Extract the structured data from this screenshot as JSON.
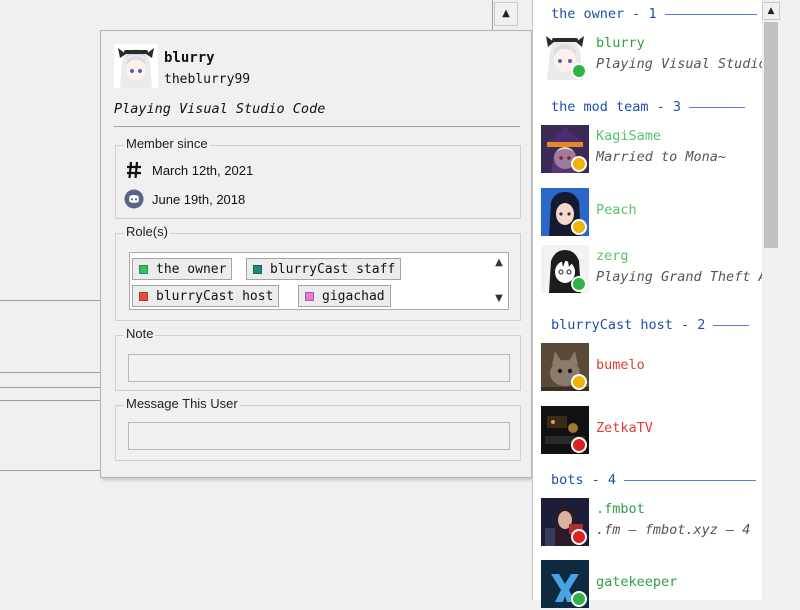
{
  "popup": {
    "display_name": "blurry",
    "username": "theblurry99",
    "status": "Playing Visual Studio Code",
    "member_since": {
      "title": "Member since",
      "server_date": "March 12th, 2021",
      "discord_date": "June 19th, 2018"
    },
    "roles": {
      "title": "Role(s)",
      "items": [
        {
          "name": "the owner",
          "color": "#33c266"
        },
        {
          "name": "blurryCast staff",
          "color": "#1f8a76"
        },
        {
          "name": "blurryCast host",
          "color": "#e74c3c"
        },
        {
          "name": "gigachad",
          "color": "#e27be0"
        }
      ]
    },
    "note": {
      "title": "Note",
      "value": ""
    },
    "message": {
      "title": "Message This User",
      "value": ""
    }
  },
  "members": {
    "sections": [
      {
        "header": "the owner - 1",
        "members": [
          {
            "name": "blurry",
            "activity": "Playing Visual Studio Code",
            "name_color": "#2f9e44",
            "status": "online"
          }
        ]
      },
      {
        "header": "the mod team - 3",
        "members": [
          {
            "name": "KagiSame",
            "activity": "Married to Mona~",
            "name_color": "#57c26a",
            "status": "idle"
          },
          {
            "name": "Peach",
            "activity": "",
            "name_color": "#57c26a",
            "status": "idle"
          },
          {
            "name": "zerg",
            "activity": "Playing Grand Theft Auto V",
            "name_color": "#57c26a",
            "status": "online"
          }
        ]
      },
      {
        "header": "blurryCast host - 2",
        "members": [
          {
            "name": "bumelo",
            "activity": "",
            "name_color": "#e23b2e",
            "status": "idle"
          },
          {
            "name": "ZetkaTV",
            "activity": "",
            "name_color": "#e23b2e",
            "status": "dnd"
          }
        ]
      },
      {
        "header": "bots - 4",
        "members": [
          {
            "name": ".fmbot",
            "activity": ".fm — fmbot.xyz — 4",
            "name_color": "#2f9e44",
            "status": "dnd"
          },
          {
            "name": "gatekeeper",
            "activity": "",
            "name_color": "#2f9e44",
            "status": "online"
          }
        ]
      }
    ]
  },
  "status_colors": {
    "online": "#2fb344",
    "idle": "#f0b400",
    "dnd": "#e02020"
  }
}
